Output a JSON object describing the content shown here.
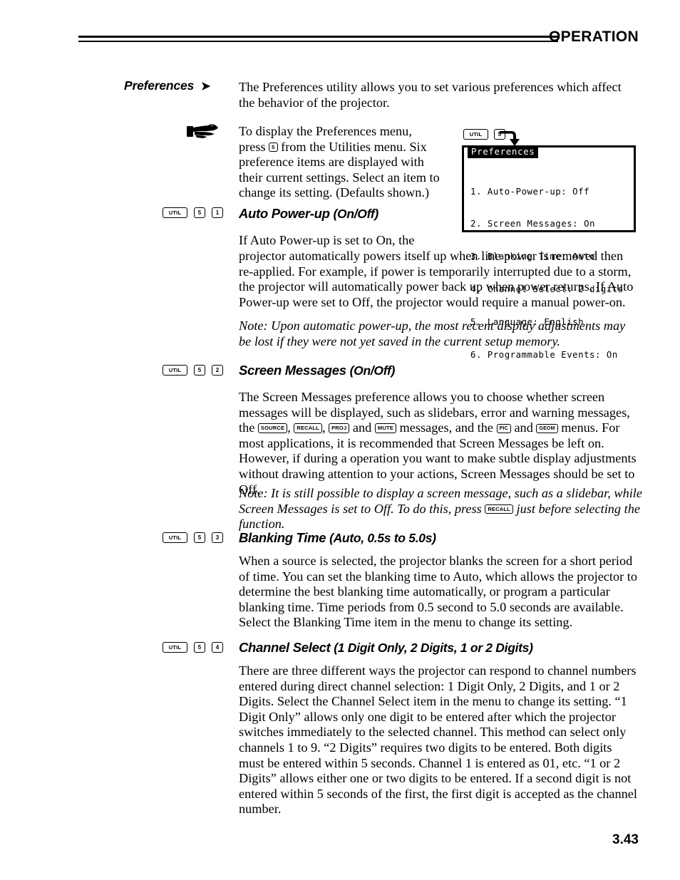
{
  "header": {
    "title": "OPERATION",
    "rule_icon": "double-rule"
  },
  "side_heading": {
    "label": "Preferences",
    "arrow": "➤"
  },
  "intro": {
    "text": "The Preferences utility allows you to set various preferences which affect the behavior of the projector."
  },
  "tip": {
    "icon": "pointing-hand-icon",
    "line1": "To display the Preferences menu,",
    "line2_before": "press ",
    "line2_key": "5",
    "line2_after": " from the Utilities menu. Six",
    "line3": "preference items are displayed with",
    "line4": "their current settings. Select an item to",
    "line5": "change its setting. (Defaults shown.)"
  },
  "osd": {
    "keys": [
      "UTIL",
      "5"
    ],
    "arrow_icon": "curved-arrow-icon",
    "title": "Preferences",
    "items": [
      "1. Auto-Power-up: Off",
      "2. Screen Messages: On",
      "3. Blanking Time: Auto",
      "4. Channel Select: 2 digits",
      "5. Language: English",
      "6. Programmable Events: On"
    ]
  },
  "sections": [
    {
      "id": "auto-power-up",
      "keys": [
        "UTIL",
        "5",
        "1"
      ],
      "heading_name": "Auto Power-up",
      "heading_paren": "(On/Off)",
      "body_narrow": "If Auto Power-up is set to On, the",
      "body_wide": "projector automatically powers itself up when line power is removed then re-applied. For example, if power is temporarily interrupted due to a storm, the projector will automatically power back up when power returns. If Auto Power-up were set to Off, the projector would require a manual power-on.",
      "note": "Note: Upon automatic power-up, the most recent display adjustments may be lost if they were not yet saved in the current setup memory."
    },
    {
      "id": "screen-messages",
      "keys": [
        "UTIL",
        "5",
        "2"
      ],
      "heading_name": "Screen Messages",
      "heading_paren": "(On/Off)",
      "body_part1": "The Screen Messages preference allows you to choose whether screen messages will be displayed, such as slidebars, error and warning messages, the ",
      "inline_keys": [
        "SOURCE",
        "RECALL",
        "PROJ",
        "MUTE",
        "PIC",
        "GEOM"
      ],
      "body_sep1": ", ",
      "body_sep2": ", ",
      "body_sep3": " and ",
      "body_sep4": " messages, and the ",
      "body_sep5": " and ",
      "body_part2": " menus. For most applications, it is recommended that Screen Messages be left on. However, if during a operation you want to make subtle display adjustments without drawing attention to your actions, Screen Messages should be set to Off.",
      "note_before": "Note: It is still possible to display a screen message, such as a slidebar, while Screen Messages is set to Off. To do this, press ",
      "note_key": "RECALL",
      "note_after": " just before selecting the function."
    },
    {
      "id": "blanking-time",
      "keys": [
        "UTIL",
        "5",
        "3"
      ],
      "heading_name": "Blanking Time",
      "heading_paren": "(Auto, 0.5s to 5.0s)",
      "body": "When a source is selected, the projector blanks the screen for a short period of time. You can set the blanking time to Auto, which allows the projector to determine the best blanking time automatically, or program a particular blanking time. Time periods from 0.5 second to 5.0 seconds are available. Select the Blanking Time item in the menu to change its setting."
    },
    {
      "id": "channel-select",
      "keys": [
        "UTIL",
        "5",
        "4"
      ],
      "heading_name": "Channel Select",
      "heading_paren": "(1 Digit Only, 2 Digits, 1 or 2 Digits)",
      "body": "There are three different ways the projector can respond to channel numbers entered during direct channel selection: 1 Digit Only, 2 Digits, and 1 or 2 Digits. Select the Channel Select item in the menu to change its setting. “1 Digit Only” allows only one digit to be entered after which the projector switches immediately to the selected channel. This method can select only channels 1 to 9. “2 Digits” requires two digits to be entered. Both digits must be entered within 5 seconds. Channel 1 is entered as 01, etc. “1 or 2 Digits” allows either one or two digits to be entered. If a second digit is not entered within 5 seconds of the first, the first digit is accepted as the channel number."
    }
  ],
  "footer": {
    "page_number": "3.43"
  }
}
